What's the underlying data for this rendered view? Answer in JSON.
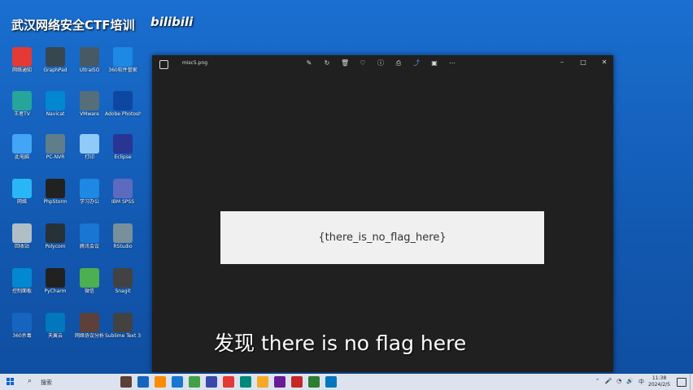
{
  "watermark": "武汉网络安全CTF培训",
  "bilibili": "bilibili",
  "desktop_icons": [
    {
      "label": "网络通知",
      "color": "#e53935"
    },
    {
      "label": "GraphPad",
      "color": "#37474f"
    },
    {
      "label": "UltraISO",
      "color": "#455a64"
    },
    {
      "label": "360软件管家",
      "color": "#1e88e5"
    },
    {
      "label": "王者TV",
      "color": "#26a69a"
    },
    {
      "label": "Navicat",
      "color": "#0288d1"
    },
    {
      "label": "VMware",
      "color": "#546e7a"
    },
    {
      "label": "Adobe Photoshop",
      "color": "#0d47a1"
    },
    {
      "label": "此电脑",
      "color": "#42a5f5"
    },
    {
      "label": "PC-NVR",
      "color": "#607d8b"
    },
    {
      "label": "打印",
      "color": "#90caf9"
    },
    {
      "label": "Eclipse",
      "color": "#283593"
    },
    {
      "label": "网络",
      "color": "#29b6f6"
    },
    {
      "label": "PhpStorm",
      "color": "#212121"
    },
    {
      "label": "学习办公",
      "color": "#1e88e5"
    },
    {
      "label": "IBM SPSS",
      "color": "#5c6bc0"
    },
    {
      "label": "回收站",
      "color": "#b0bec5"
    },
    {
      "label": "Polycom",
      "color": "#263238"
    },
    {
      "label": "腾讯会议",
      "color": "#1976d2"
    },
    {
      "label": "RStudio",
      "color": "#78909c"
    },
    {
      "label": "控制面板",
      "color": "#0288d1"
    },
    {
      "label": "PyCharm",
      "color": "#212121"
    },
    {
      "label": "微信",
      "color": "#4caf50"
    },
    {
      "label": "Snagit",
      "color": "#424242"
    },
    {
      "label": "360杀毒",
      "color": "#1565c0"
    },
    {
      "label": "天翼云",
      "color": "#0277bd"
    },
    {
      "label": "网络协议分析",
      "color": "#5d4037"
    },
    {
      "label": "Sublime Text 3",
      "color": "#424242"
    }
  ],
  "viewer": {
    "filename": "misc5.png",
    "tools": [
      "edit-icon",
      "rotate-icon",
      "delete-icon",
      "favorite-icon",
      "info-icon",
      "print-icon",
      "share-icon",
      "slideshow-icon",
      "more-icon"
    ],
    "flag_text": "{there_is_no_flag_here}"
  },
  "caption": "发现 there is no flag here",
  "taskbar": {
    "search_placeholder": "搜索",
    "apps": [
      "#5d4037",
      "#1565c0",
      "#fb8c00",
      "#1976d2",
      "#43a047",
      "#3949ab",
      "#e53935",
      "#00897b",
      "#f9a825",
      "#6a1b9a",
      "#c62828",
      "#2e7d32",
      "#0277bd"
    ],
    "time": "11:38",
    "date": "2024/2/5"
  }
}
